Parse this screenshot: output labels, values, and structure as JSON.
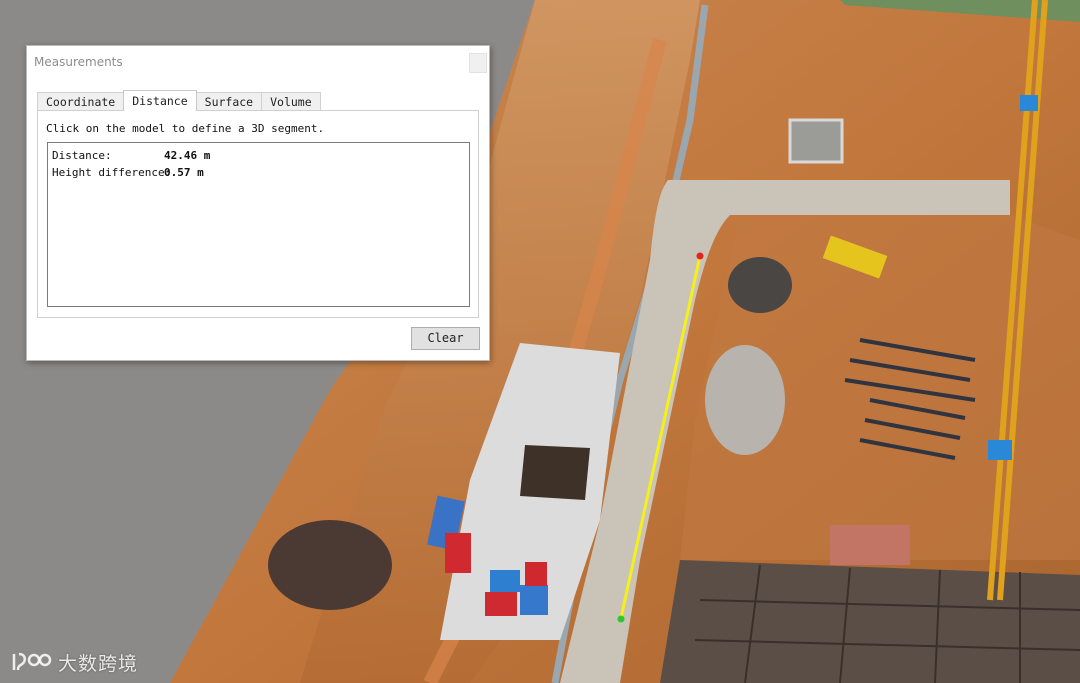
{
  "window": {
    "title": "Measurements"
  },
  "tabs": [
    {
      "label": "Coordinate",
      "active": false
    },
    {
      "label": "Distance",
      "active": true
    },
    {
      "label": "Surface",
      "active": false
    },
    {
      "label": "Volume",
      "active": false
    }
  ],
  "distance_panel": {
    "instruction": "Click on the model to define a 3D segment.",
    "results": [
      {
        "label": "Distance:",
        "value": "42.46 m"
      },
      {
        "label": "Height difference:",
        "value": "0.57 m"
      }
    ],
    "clear_label": "Clear"
  },
  "watermark": {
    "text": "大数跨境"
  },
  "colors": {
    "measure_line": "#f5f01a",
    "start_point": "#e52222",
    "end_point": "#2ec62e",
    "viewport_bg": "#8c8a88"
  }
}
